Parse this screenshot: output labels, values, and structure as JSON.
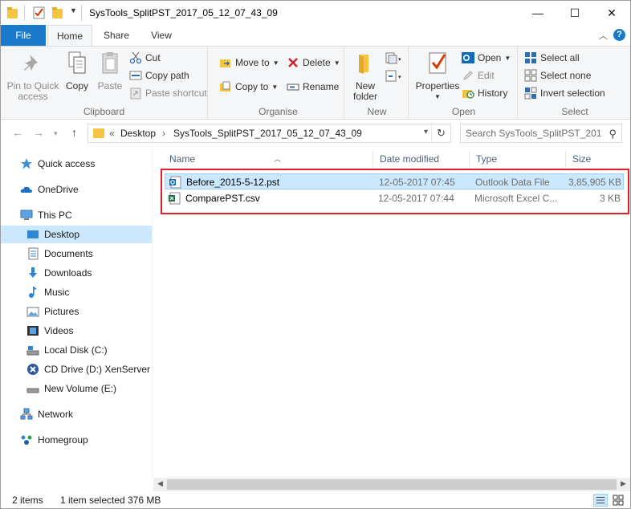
{
  "window": {
    "title": "SysTools_SplitPST_2017_05_12_07_43_09",
    "minimize_glyph": "—",
    "maximize_glyph": "☐",
    "close_glyph": "✕"
  },
  "tabs": {
    "file": "File",
    "home": "Home",
    "share": "Share",
    "view": "View",
    "help": "?"
  },
  "ribbon": {
    "clipboard": {
      "label": "Clipboard",
      "pin": "Pin to Quick access",
      "copy": "Copy",
      "paste": "Paste",
      "cut": "Cut",
      "copy_path": "Copy path",
      "paste_shortcut": "Paste shortcut"
    },
    "organise": {
      "label": "Organise",
      "move_to": "Move to",
      "copy_to": "Copy to",
      "delete": "Delete",
      "rename": "Rename"
    },
    "new": {
      "label": "New",
      "new_folder": "New folder"
    },
    "open": {
      "label": "Open",
      "properties": "Properties",
      "open": "Open",
      "edit": "Edit",
      "history": "History"
    },
    "select": {
      "label": "Select",
      "select_all": "Select all",
      "select_none": "Select none",
      "invert": "Invert selection"
    }
  },
  "address": {
    "prefix": "«",
    "crumb1": "Desktop",
    "sep": "›",
    "crumb2": "SysTools_SplitPST_2017_05_12_07_43_09",
    "search_placeholder": "Search SysTools_SplitPST_201..."
  },
  "nav": {
    "quick_access": "Quick access",
    "onedrive": "OneDrive",
    "this_pc": "This PC",
    "desktop": "Desktop",
    "documents": "Documents",
    "downloads": "Downloads",
    "music": "Music",
    "pictures": "Pictures",
    "videos": "Videos",
    "local_disk": "Local Disk (C:)",
    "cd_drive": "CD Drive (D:) XenServer To",
    "new_volume": "New Volume (E:)",
    "network": "Network",
    "homegroup": "Homegroup"
  },
  "columns": {
    "name": "Name",
    "date": "Date modified",
    "type": "Type",
    "size": "Size"
  },
  "files": [
    {
      "name": "Before_2015-5-12.pst",
      "date": "12-05-2017 07:45",
      "type": "Outlook Data File",
      "size": "3,85,905 KB"
    },
    {
      "name": "ComparePST.csv",
      "date": "12-05-2017 07:44",
      "type": "Microsoft Excel C...",
      "size": "3 KB"
    }
  ],
  "status": {
    "items": "2 items",
    "selected": "1 item selected",
    "size": "376 MB"
  },
  "colors": {
    "accent": "#1979ca",
    "selection": "#cce8ff",
    "highlight_box": "#e0202a"
  }
}
